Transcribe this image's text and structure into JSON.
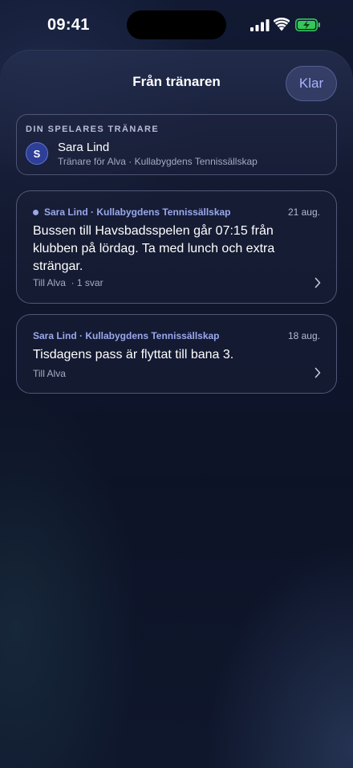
{
  "status_bar": {
    "time": "09:41"
  },
  "sheet": {
    "title": "Från tränaren",
    "done_label": "Klar"
  },
  "coach": {
    "caption": "DIN SPELARES TRÄNARE",
    "avatar_letter": "S",
    "name": "Sara Lind",
    "subtitle": "Tränare för Alva · Kullabygdens Tennissällskap"
  },
  "messages": [
    {
      "sender": "Sara Lind · Kullabygdens Tennissällskap",
      "date": "21 aug.",
      "text": "Bussen till Havsbadsspelen går 07:15 från klubben på lördag. Ta med lunch och extra strängar.",
      "meta": "Till Alva  · 1 svar",
      "unread": true
    },
    {
      "sender": "Sara Lind · Kullabygdens Tennissällskap",
      "date": "18 aug.",
      "text": "Tisdagens pass är flyttat till bana 3.",
      "meta": "Till Alva",
      "unread": false
    }
  ],
  "icons": [
    "signal-icon",
    "wifi-icon",
    "battery-charging-icon",
    "chevron-right-icon"
  ],
  "colors": {
    "accent": "#9aa8ec",
    "done_text": "#a9b3ff",
    "battery": "#34c759"
  }
}
